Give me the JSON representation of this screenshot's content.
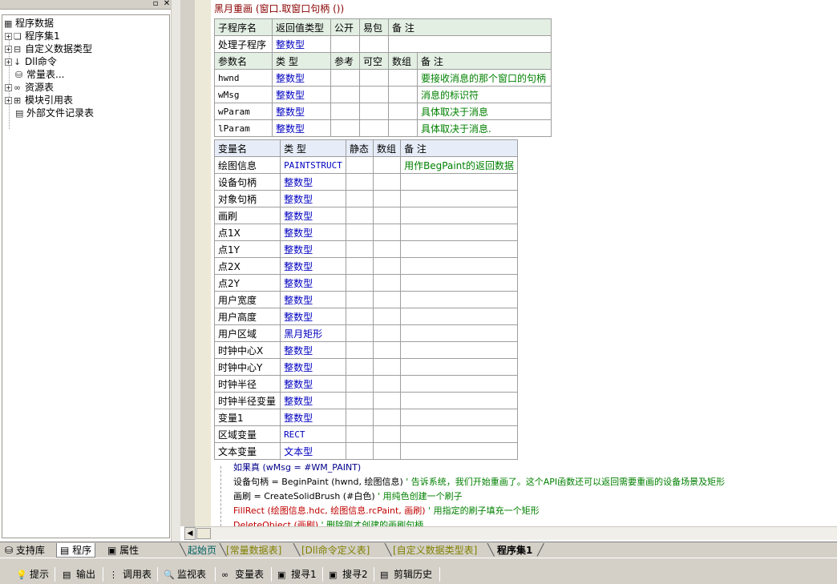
{
  "tree": {
    "root": "程序数据",
    "items": [
      {
        "label": "程序集1",
        "icon": "assembly-icon"
      },
      {
        "label": "自定义数据类型",
        "icon": "datatype-icon"
      },
      {
        "label": "Dll命令",
        "icon": "dll-icon"
      },
      {
        "label": "常量表...",
        "icon": "constant-icon"
      },
      {
        "label": "资源表",
        "icon": "resource-icon"
      },
      {
        "label": "模块引用表",
        "icon": "module-icon"
      },
      {
        "label": "外部文件记录表",
        "icon": "file-icon"
      }
    ]
  },
  "left_tabs": [
    "支持库",
    "程序",
    "属性"
  ],
  "editor": {
    "header": "黑月重画 (窗口.取窗口句柄 ())",
    "sub_table": {
      "headers": [
        "子程序名",
        "返回值类型",
        "公开",
        "易包",
        "备 注"
      ],
      "row": {
        "name": "处理子程序",
        "type": "整数型"
      },
      "param_headers": [
        "参数名",
        "类 型",
        "参考",
        "可空",
        "数组",
        "备 注"
      ],
      "params": [
        {
          "name": "hwnd",
          "type": "整数型",
          "note": "要接收消息的那个窗口的句柄"
        },
        {
          "name": "wMsg",
          "type": "整数型",
          "note": "消息的标识符"
        },
        {
          "name": "wParam",
          "type": "整数型",
          "note": "具体取决于消息"
        },
        {
          "name": "lParam",
          "type": "整数型",
          "note": "具体取决于消息."
        }
      ]
    },
    "var_table": {
      "headers": [
        "变量名",
        "类 型",
        "静态",
        "数组",
        "备 注"
      ],
      "vars": [
        {
          "name": "绘图信息",
          "type": "PAINTSTRUCT",
          "note": "用作BegPaint的返回数据"
        },
        {
          "name": "设备句柄",
          "type": "整数型",
          "note": ""
        },
        {
          "name": "对象句柄",
          "type": "整数型",
          "note": ""
        },
        {
          "name": "画刷",
          "type": "整数型",
          "note": ""
        },
        {
          "name": "点1X",
          "type": "整数型",
          "note": ""
        },
        {
          "name": "点1Y",
          "type": "整数型",
          "note": ""
        },
        {
          "name": "点2X",
          "type": "整数型",
          "note": ""
        },
        {
          "name": "点2Y",
          "type": "整数型",
          "note": ""
        },
        {
          "name": "用户宽度",
          "type": "整数型",
          "note": ""
        },
        {
          "name": "用户高度",
          "type": "整数型",
          "note": ""
        },
        {
          "name": "用户区域",
          "type": "黑月矩形",
          "note": ""
        },
        {
          "name": "时钟中心X",
          "type": "整数型",
          "note": ""
        },
        {
          "name": "时钟中心Y",
          "type": "整数型",
          "note": ""
        },
        {
          "name": "时钟半径",
          "type": "整数型",
          "note": ""
        },
        {
          "name": "时钟半径变量",
          "type": "整数型",
          "note": ""
        },
        {
          "name": "变量1",
          "type": "整数型",
          "note": ""
        },
        {
          "name": "区域变量",
          "type": "RECT",
          "note": ""
        },
        {
          "name": "文本变量",
          "type": "文本型",
          "note": ""
        }
      ]
    },
    "code": {
      "if_line": "如果真 (wMsg = #WM_PAINT)",
      "line1_code": "设备句柄 = BeginPaint (hwnd, 绘图信息)",
      "line1_comment": "' 告诉系统，我们开始重画了。这个API函数还可以返回需要重画的设备场景及矩形",
      "line2_code": "画刷 = CreateSolidBrush (#白色)",
      "line2_comment": "' 用纯色创建一个刷子",
      "line3_code": "FillRect (绘图信息.hdc, 绘图信息.rcPaint, 画刷)",
      "line3_comment": "' 用指定的刷子填充一个矩形",
      "line4_code": "DeleteObject (画刷)",
      "line4_comment": "' 删除刚才创建的画刷句柄"
    }
  },
  "editor_tabs": [
    "起始页",
    "[常量数据表]",
    "[Dll命令定义表]",
    "[自定义数据类型表]",
    "程序集1"
  ],
  "bottom_buttons": [
    {
      "label": "提示",
      "icon": "hint-icon"
    },
    {
      "label": "输出",
      "icon": "output-icon"
    },
    {
      "label": "调用表",
      "icon": "callstack-icon"
    },
    {
      "label": "监视表",
      "icon": "watch-icon"
    },
    {
      "label": "变量表",
      "icon": "variables-icon"
    },
    {
      "label": "搜寻1",
      "icon": "search1-icon"
    },
    {
      "label": "搜寻2",
      "icon": "search2-icon"
    },
    {
      "label": "剪辑历史",
      "icon": "clipboard-icon"
    }
  ]
}
